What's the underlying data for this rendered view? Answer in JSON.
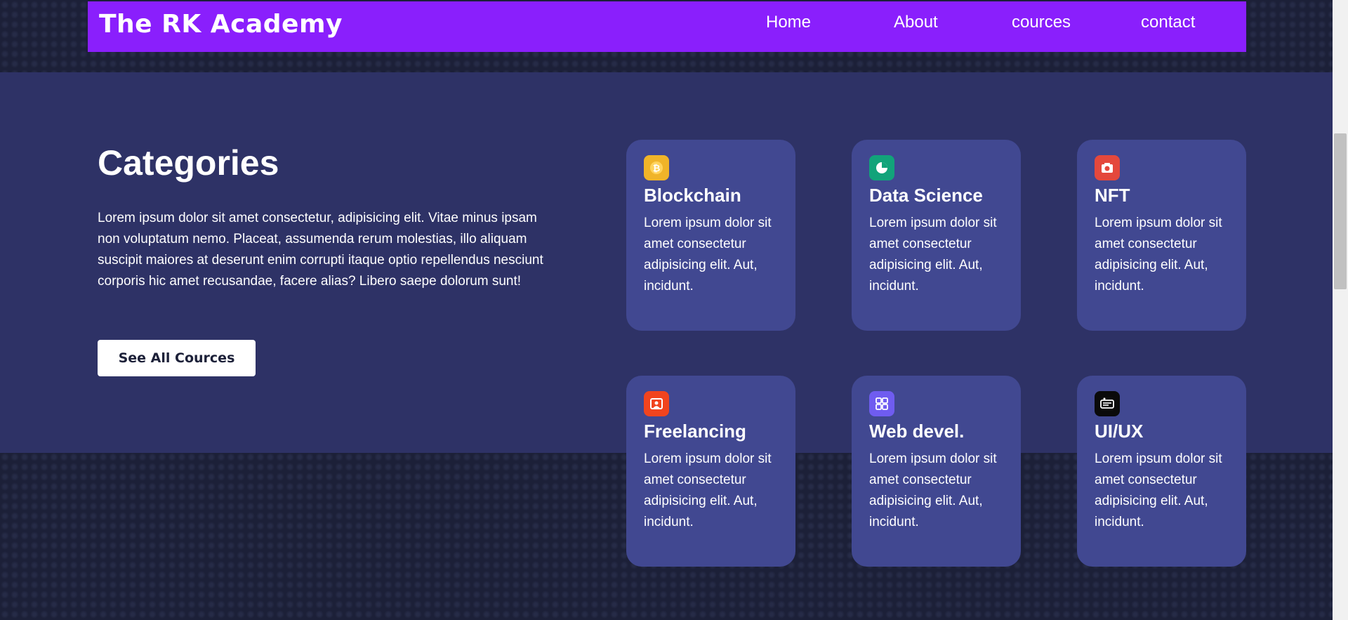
{
  "navbar": {
    "logo": "The RK Academy",
    "links": [
      {
        "label": "Home"
      },
      {
        "label": "About"
      },
      {
        "label": "cources"
      },
      {
        "label": "contact"
      }
    ]
  },
  "categories": {
    "title": "Categories",
    "description": "Lorem ipsum dolor sit amet consectetur, adipisicing elit. Vitae minus ipsam non voluptatum nemo. Placeat, assumenda rerum molestias, illo aliquam suscipit maiores at deserunt enim corrupti itaque optio repellendus nesciunt corporis hic amet recusandae, facere alias? Libero saepe dolorum sunt!",
    "button_label": "See All Cources",
    "cards": [
      {
        "title": "Blockchain",
        "text": "Lorem ipsum dolor sit amet consectetur adipisicing elit. Aut, incidunt.",
        "icon": "bitcoin-icon",
        "icon_color": "#f0b429"
      },
      {
        "title": "Data Science",
        "text": "Lorem ipsum dolor sit amet consectetur adipisicing elit. Aut, incidunt.",
        "icon": "pie-chart-icon",
        "icon_color": "#12a37a"
      },
      {
        "title": "NFT",
        "text": "Lorem ipsum dolor sit amet consectetur adipisicing elit. Aut, incidunt.",
        "icon": "camera-icon",
        "icon_color": "#e4483c"
      },
      {
        "title": "Freelancing",
        "text": "Lorem ipsum dolor sit amet consectetur adipisicing elit. Aut, incidunt.",
        "icon": "presentation-icon",
        "icon_color": "#f1441e"
      },
      {
        "title": "Web devel.",
        "text": "Lorem ipsum dolor sit amet consectetur adipisicing elit. Aut, incidunt.",
        "icon": "layout-grid-icon",
        "icon_color": "#6f5cf0"
      },
      {
        "title": "UI/UX",
        "text": "Lorem ipsum dolor sit amet consectetur adipisicing elit. Aut, incidunt.",
        "icon": "id-card-icon",
        "icon_color": "#0a0a0a"
      }
    ]
  },
  "colors": {
    "navbar_bg": "#8a1ffc",
    "section_bg": "#2e3266",
    "card_bg": "#414891",
    "page_bg": "#1c2038"
  }
}
